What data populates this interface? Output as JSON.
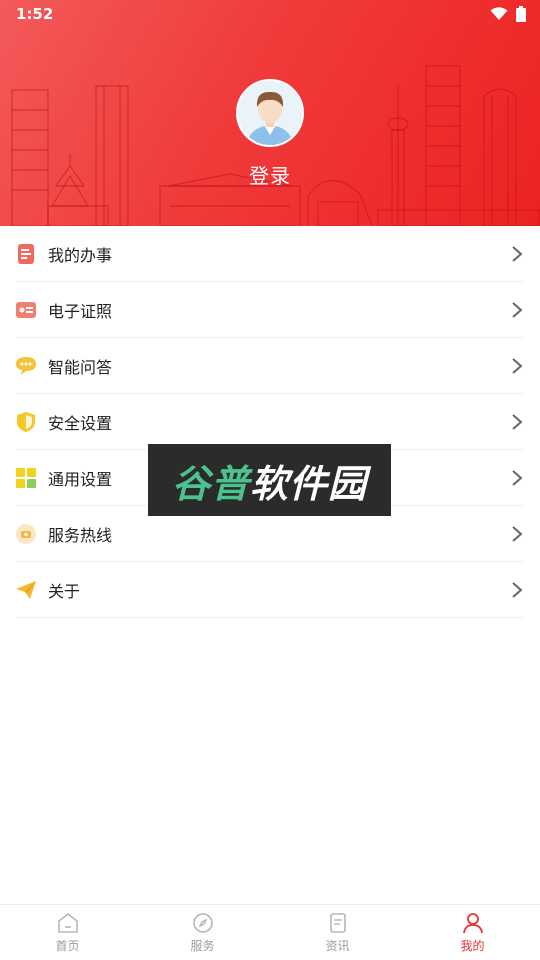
{
  "status_bar": {
    "time": "1:52",
    "wifi_icon": "wifi-icon",
    "battery_icon": "battery-icon"
  },
  "profile": {
    "login_label": "登录",
    "avatar_icon": "user-avatar"
  },
  "menu": {
    "items": [
      {
        "label": "我的办事",
        "icon": "document-icon",
        "color": "#ee6a5f"
      },
      {
        "label": "电子证照",
        "icon": "id-card-icon",
        "color": "#f07f6f"
      },
      {
        "label": "智能问答",
        "icon": "chat-bubble-icon",
        "color": "#f6c23a"
      },
      {
        "label": "安全设置",
        "icon": "shield-icon",
        "color": "#f3c92a"
      },
      {
        "label": "通用设置",
        "icon": "grid-icon",
        "color": "#f3d21c"
      },
      {
        "label": "服务热线",
        "icon": "phone-icon",
        "color": "#f2c47a"
      },
      {
        "label": "关于",
        "icon": "paper-plane-icon",
        "color": "#f6b82c"
      }
    ]
  },
  "watermark": {
    "part1": "谷普",
    "part2": "软件园"
  },
  "tabbar": {
    "tabs": [
      {
        "label": "首页",
        "icon": "home-icon",
        "active": false
      },
      {
        "label": "服务",
        "icon": "compass-icon",
        "active": false
      },
      {
        "label": "资讯",
        "icon": "news-icon",
        "active": false
      },
      {
        "label": "我的",
        "icon": "person-icon",
        "active": true
      }
    ]
  },
  "colors": {
    "header_red": "#ef3636",
    "active_tab": "#e8322f",
    "inactive_tab": "#9b9b9b"
  }
}
